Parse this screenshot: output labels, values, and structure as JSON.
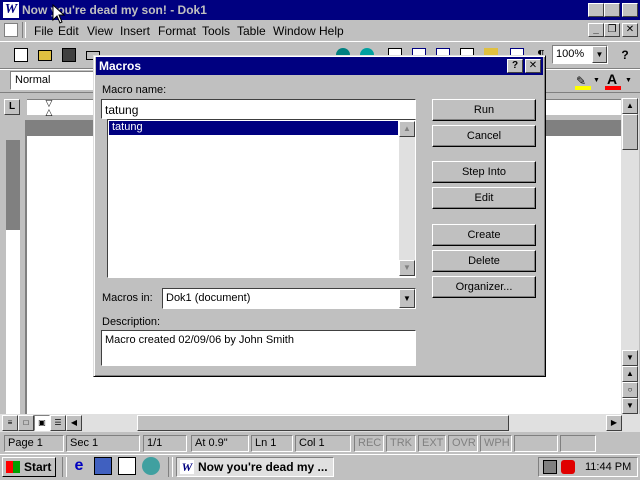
{
  "window": {
    "title": "Now you're dead my son! - Dok1",
    "app_icon": "W"
  },
  "menu": {
    "items": [
      "File",
      "Edit",
      "View",
      "Insert",
      "Format",
      "Tools",
      "Table",
      "Window",
      "Help"
    ]
  },
  "toolbar": {
    "zoom": "100%",
    "style": "Normal",
    "help": "?"
  },
  "dialog": {
    "title": "Macros",
    "help": "?",
    "macro_name_label": "Macro name:",
    "macro_name_value": "tatung",
    "macros": [
      "tatung"
    ],
    "macros_in_label": "Macros in:",
    "macros_in_value": "Dok1 (document)",
    "description_label": "Description:",
    "description_value": "Macro created 02/09/06 by John Smith",
    "buttons": {
      "run": "Run",
      "cancel": "Cancel",
      "step_into": "Step Into",
      "edit": "Edit",
      "create": "Create",
      "delete": "Delete",
      "organizer": "Organizer..."
    }
  },
  "status": {
    "page": "Page 1",
    "sec": "Sec 1",
    "pages": "1/1",
    "at": "At  0.9\"",
    "ln": "Ln  1",
    "col": "Col  1",
    "rec": "REC",
    "trk": "TRK",
    "ext": "EXT",
    "ovr": "OVR",
    "wph": "WPH"
  },
  "taskbar": {
    "start": "Start",
    "task": "Now you're dead my ...",
    "clock": "11:44 PM"
  }
}
